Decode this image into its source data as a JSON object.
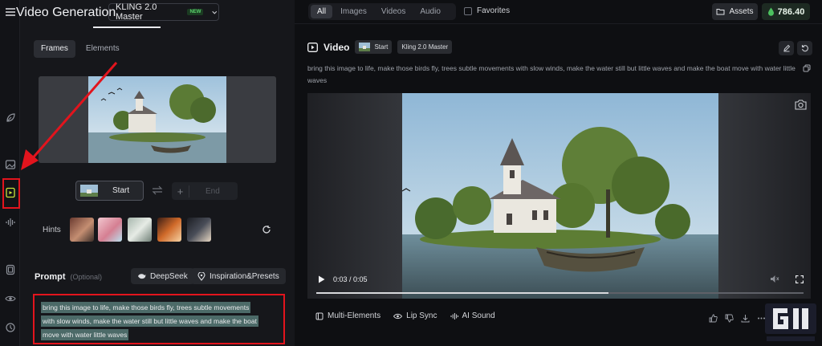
{
  "header": {
    "title": "Video Generation",
    "model": "KLING 2.0 Master",
    "model_badge": "NEW"
  },
  "frame_tabs": [
    "Frames",
    "Elements"
  ],
  "frames": {
    "start_label": "Start",
    "end_label": "End"
  },
  "hints": {
    "label": "Hints"
  },
  "prompt": {
    "label": "Prompt",
    "optional": "(Optional)",
    "deepseek_label": "DeepSeek",
    "inspiration_label": "Inspiration&Presets",
    "lines": [
      "bring this image to life, make those birds fly, trees subtle movements",
      "with slow winds, make the water still but little waves and make the boat",
      "move with water little waves"
    ]
  },
  "filters": {
    "tabs": [
      "All",
      "Images",
      "Videos",
      "Audio"
    ],
    "favorites_label": "Favorites"
  },
  "top_right": {
    "assets_label": "Assets",
    "credits": "786.40"
  },
  "video": {
    "title": "Video",
    "start_chip": "Start",
    "model_chip": "Kling 2.0 Master",
    "prompt": "bring this image to life, make those birds fly, trees subtle movements with slow winds, make the water still but little waves and make the boat move with water little waves",
    "time": "0:03 / 0:05",
    "progress": 0.6
  },
  "tools": [
    "Multi-Elements",
    "Lip Sync",
    "AI Sound"
  ],
  "colors": {
    "highlight_red": "#e2141d",
    "credit_green": "#4cc15f"
  }
}
